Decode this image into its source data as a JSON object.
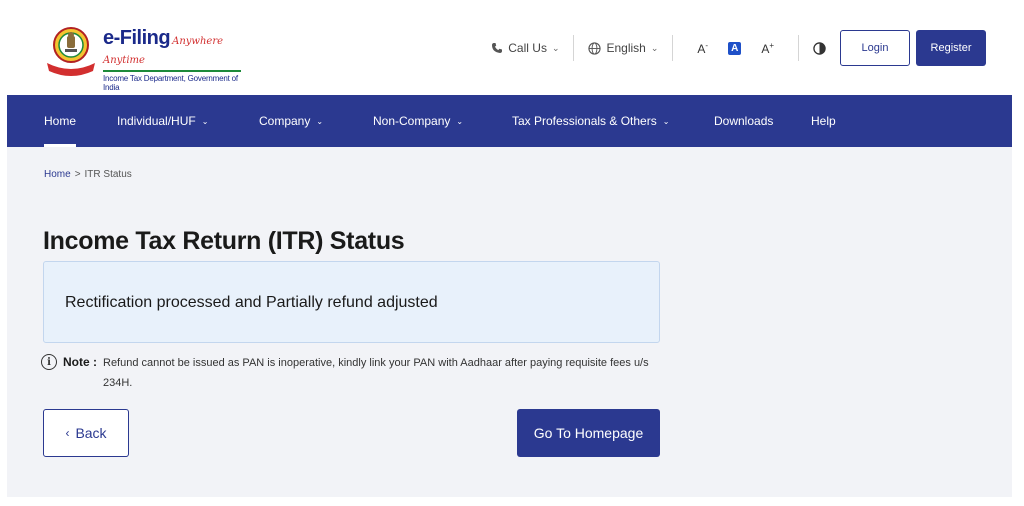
{
  "header": {
    "brand_main": "e-Filing",
    "brand_tagline": "Anywhere Anytime",
    "brand_subtitle": "Income Tax Department, Government of India",
    "call_us": "Call Us",
    "language": "English",
    "font_decrease": "A",
    "font_default": "A",
    "font_increase": "A",
    "login": "Login",
    "register": "Register",
    "colors": {
      "primary": "#2b3990",
      "accent_red": "#d22f2f",
      "accent_green": "#1d8a3a"
    }
  },
  "nav": {
    "items": [
      {
        "label": "Home",
        "has_dropdown": false,
        "active": true
      },
      {
        "label": "Individual/HUF",
        "has_dropdown": true
      },
      {
        "label": "Company",
        "has_dropdown": true
      },
      {
        "label": "Non-Company",
        "has_dropdown": true
      },
      {
        "label": "Tax Professionals & Others",
        "has_dropdown": true
      },
      {
        "label": "Downloads",
        "has_dropdown": false
      },
      {
        "label": "Help",
        "has_dropdown": false
      }
    ]
  },
  "breadcrumb": {
    "home": "Home",
    "separator": ">",
    "current": "ITR Status"
  },
  "main": {
    "title": "Income Tax Return (ITR) Status",
    "status_message": "Rectification processed and Partially refund adjusted",
    "note_icon": "i",
    "note_label": "Note :",
    "note_text": "Refund cannot be issued as PAN is inoperative, kindly link your PAN with Aadhaar after paying requisite fees u/s 234H.",
    "back_button": "Back",
    "homepage_button": "Go To Homepage"
  },
  "icons": [
    "emblem-logo",
    "phone-icon",
    "globe-icon",
    "chevron-down-icon",
    "contrast-icon",
    "info-icon",
    "chevron-left-icon"
  ]
}
